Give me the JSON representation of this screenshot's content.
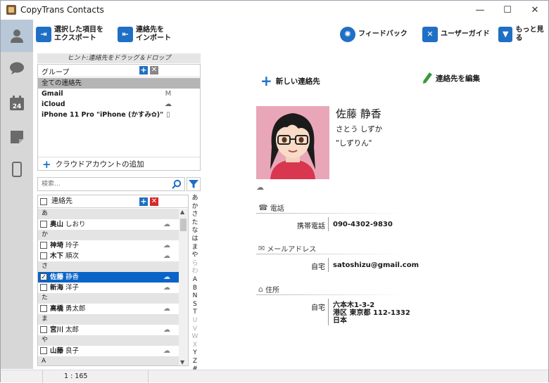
{
  "app": {
    "title": "CopyTrans Contacts"
  },
  "window_controls": {
    "minimize": "—",
    "maximize": "☐",
    "close": "✕"
  },
  "toolbar": {
    "export_label_1": "選択した項目を",
    "export_label_2": "エクスポート",
    "import_label_1": "連絡先を",
    "import_label_2": "インポート",
    "feedback_label": "フィードバック",
    "guide_label": "ユーザーガイド",
    "more_label": "もっと見る"
  },
  "groups": {
    "hint": "ヒント:連絡先をドラッグ＆ドロップ",
    "header": "グループ",
    "items": [
      {
        "label": "全ての連絡先",
        "selected": true,
        "icon": ""
      },
      {
        "label": "Gmail",
        "bold": true,
        "icon": "M"
      },
      {
        "label": "iCloud",
        "bold": true,
        "icon": "☁"
      },
      {
        "label": "iPhone 11 Pro \"iPhone (かすみ✿)\"",
        "bold": true,
        "icon": "▯"
      }
    ],
    "add_cloud": "クラウドアカウントの追加"
  },
  "search": {
    "placeholder": "検索..."
  },
  "contacts": {
    "header": "連絡先",
    "rows": [
      {
        "type": "section",
        "label": "あ"
      },
      {
        "type": "contact",
        "last": "奥山",
        "first": "しおり",
        "checked": false
      },
      {
        "type": "section",
        "label": "か"
      },
      {
        "type": "contact",
        "last": "神埼",
        "first": "玲子",
        "checked": false
      },
      {
        "type": "contact",
        "last": "木下",
        "first": "順次",
        "checked": false
      },
      {
        "type": "section",
        "label": "さ"
      },
      {
        "type": "contact",
        "last": "佐藤",
        "first": "静香",
        "checked": true,
        "selected": true
      },
      {
        "type": "contact",
        "last": "新海",
        "first": "洋子",
        "checked": false
      },
      {
        "type": "section",
        "label": "た"
      },
      {
        "type": "contact",
        "last": "高橋",
        "first": "勇太郎",
        "checked": false
      },
      {
        "type": "section",
        "label": "ま"
      },
      {
        "type": "contact",
        "last": "宮川",
        "first": "太郎",
        "checked": false
      },
      {
        "type": "section",
        "label": "や"
      },
      {
        "type": "contact",
        "last": "山藤",
        "first": "良子",
        "checked": false
      },
      {
        "type": "section",
        "label": "A"
      }
    ]
  },
  "alpha_index": [
    "あ",
    "か",
    "さ",
    "た",
    "な",
    "は",
    "ま",
    "や",
    "ら",
    "わ",
    "A",
    "B",
    "N",
    "S",
    "T",
    "U",
    "V",
    "W",
    "X",
    "Y",
    "Z",
    "#"
  ],
  "alpha_dim": [
    "ら",
    "わ",
    "U",
    "V",
    "W",
    "X"
  ],
  "detail": {
    "new_contact": "新しい連絡先",
    "edit_contact": "連絡先を編集",
    "name": "佐藤 静香",
    "kana": "さとう しずか",
    "nickname": "\"しずりん\"",
    "phone_title": "電話",
    "phone_label": "携帯電話",
    "phone_value": "090-4302-9830",
    "email_title": "メールアドレス",
    "email_label": "自宅",
    "email_value": "satoshizu@gmail.com",
    "address_title": "住所",
    "address_label": "自宅",
    "address_line1": "六本木1-3-2",
    "address_line2": "港区 東京都 112-1332",
    "address_line3": "日本"
  },
  "status": {
    "count": "1 : 165"
  },
  "colors": {
    "accent": "#1f6fc5",
    "selection": "#0a64c8",
    "sidebar": "#d7d7d7"
  }
}
